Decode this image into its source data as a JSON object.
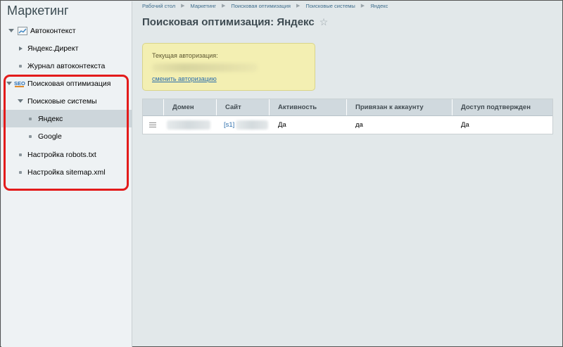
{
  "sidebar": {
    "title": "Маркетинг",
    "items": [
      {
        "label": "Автоконтекст",
        "icon": "chart-icon",
        "expanded": true
      },
      {
        "label": "Яндекс.Директ"
      },
      {
        "label": "Журнал автоконтекста"
      },
      {
        "label": "Поисковая оптимизация",
        "icon": "seo-icon",
        "expanded": true
      },
      {
        "label": "Поисковые системы",
        "expanded": true
      },
      {
        "label": "Яндекс",
        "active": true
      },
      {
        "label": "Google"
      },
      {
        "label": "Настройка robots.txt"
      },
      {
        "label": "Настройка sitemap.xml"
      }
    ]
  },
  "breadcrumb": [
    "Рабочий стол",
    "Маркетинг",
    "Поисковая оптимизация",
    "Поисковые системы",
    "Яндекс"
  ],
  "page": {
    "title": "Поисковая оптимизация: Яндекс",
    "star": "☆"
  },
  "auth": {
    "label": "Текущая авторизация:",
    "change_link": "сменить авторизацию"
  },
  "table": {
    "columns": [
      "Домен",
      "Сайт",
      "Активность",
      "Привязан к аккаунту",
      "Доступ подтвержден"
    ],
    "rows": [
      {
        "site_prefix": "[s1]",
        "active": "Да",
        "linked": "да",
        "verified": "Да"
      }
    ]
  },
  "colors": {
    "highlight_outline": "#e31b1b",
    "sidebar_active": "#cdd6db",
    "auth_box": "#f3efb2",
    "link": "#2b6dab"
  }
}
